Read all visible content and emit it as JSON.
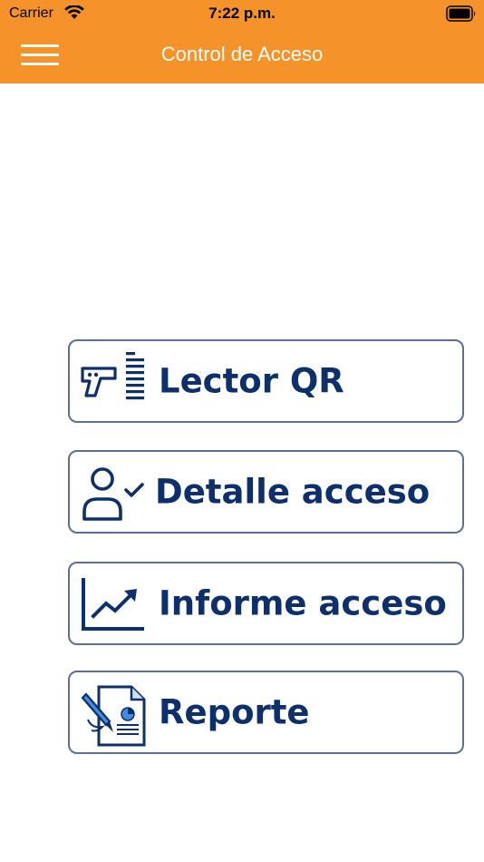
{
  "status_bar": {
    "carrier": "Carrier",
    "time": "7:22 p.m.",
    "wifi_icon": "wifi-icon",
    "battery_icon": "battery-full-icon"
  },
  "nav_bar": {
    "title": "Control de Acceso",
    "menu_icon": "hamburger-menu-icon",
    "background_color": "#f6922a"
  },
  "menu": {
    "items": [
      {
        "label": "Lector QR",
        "icon": "qr-scanner-icon"
      },
      {
        "label": "Detalle acceso",
        "icon": "user-check-icon"
      },
      {
        "label": "Informe acceso",
        "icon": "trend-chart-icon"
      },
      {
        "label": "Reporte",
        "icon": "document-report-icon"
      }
    ],
    "text_color": "#0d2f6b",
    "border_color": "#5c6f94"
  }
}
